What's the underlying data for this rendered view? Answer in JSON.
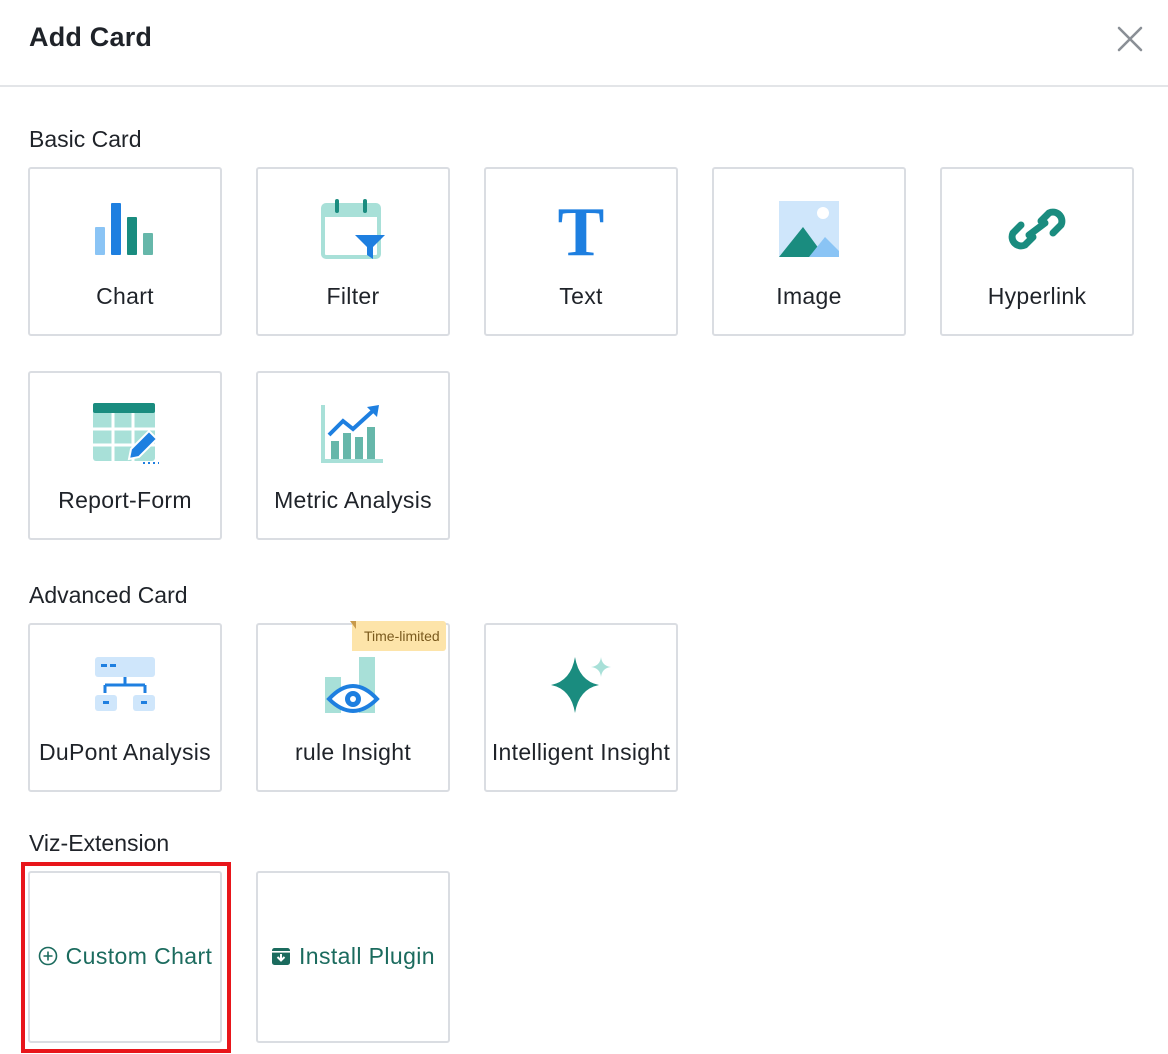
{
  "dialog": {
    "title": "Add Card",
    "close_icon": "close-icon"
  },
  "sections": {
    "basic": {
      "label": "Basic Card",
      "cards": [
        {
          "label": "Chart",
          "icon": "bar-chart-icon"
        },
        {
          "label": "Filter",
          "icon": "calendar-filter-icon"
        },
        {
          "label": "Text",
          "icon": "text-icon"
        },
        {
          "label": "Image",
          "icon": "image-icon"
        },
        {
          "label": "Hyperlink",
          "icon": "link-icon"
        },
        {
          "label": "Report-Form",
          "icon": "table-edit-icon"
        },
        {
          "label": "Metric Analysis",
          "icon": "metric-trend-icon"
        }
      ]
    },
    "advanced": {
      "label": "Advanced Card",
      "cards": [
        {
          "label": "DuPont Analysis",
          "icon": "tree-diagram-icon"
        },
        {
          "label": "rule Insight",
          "icon": "eye-insight-icon",
          "badge": "Time-limited"
        },
        {
          "label": "Intelligent Insight",
          "icon": "sparkle-icon"
        }
      ]
    },
    "viz": {
      "label": "Viz-Extension",
      "cards": [
        {
          "label": "Custom Chart",
          "icon": "plus-circle-icon"
        },
        {
          "label": "Install Plugin",
          "icon": "download-box-icon"
        }
      ]
    }
  },
  "colors": {
    "accent_teal": "#1a8c7f",
    "accent_blue": "#1e7fe0",
    "highlight_red": "#e8161b"
  }
}
